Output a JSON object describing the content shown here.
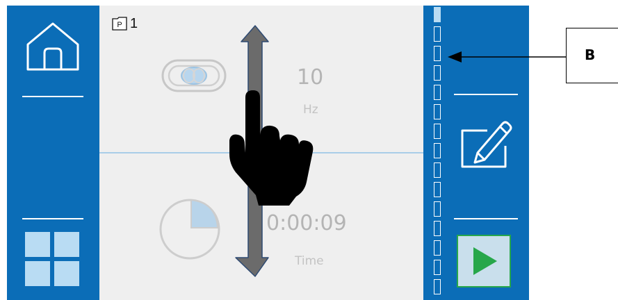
{
  "program": {
    "badge": "P",
    "number": "1"
  },
  "frequency": {
    "value": "10",
    "unit": "Hz",
    "icon": "vibration-mode-icon"
  },
  "time": {
    "value": "0:00:09",
    "unit": "Time",
    "icon": "timer-icon"
  },
  "nav": {
    "home_icon": "home-icon",
    "menu_icon": "grid-menu-icon"
  },
  "actions": {
    "edit_icon": "edit-icon",
    "play_icon": "play-icon"
  },
  "scroll": {
    "segments": 15,
    "active_index": 0
  },
  "callout": {
    "label": "B"
  },
  "colors": {
    "panel_blue": "#0b6db7",
    "light_blue": "#b9dcf3",
    "play_green": "#27a74a",
    "main_bg": "#efefef"
  }
}
